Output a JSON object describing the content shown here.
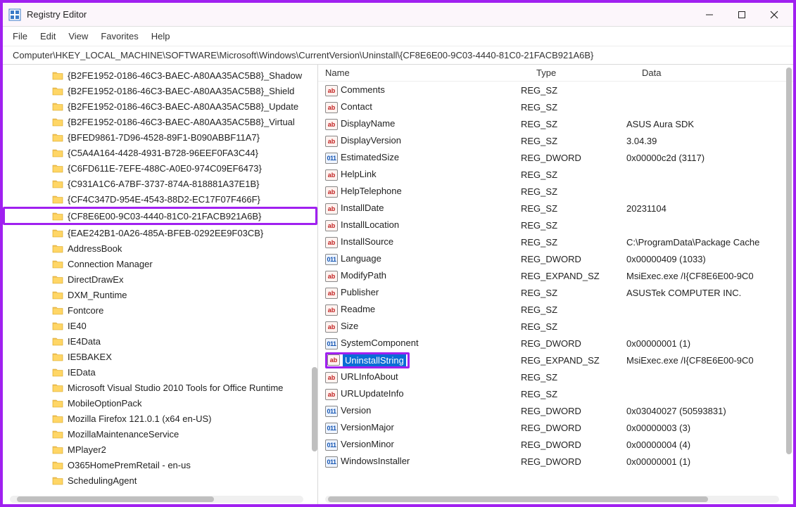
{
  "window": {
    "title": "Registry Editor"
  },
  "menu": {
    "file": "File",
    "edit": "Edit",
    "view": "View",
    "favorites": "Favorites",
    "help": "Help"
  },
  "address": "Computer\\HKEY_LOCAL_MACHINE\\SOFTWARE\\Microsoft\\Windows\\CurrentVersion\\Uninstall\\{CF8E6E00-9C03-4440-81C0-21FACB921A6B}",
  "columns": {
    "name": "Name",
    "type": "Type",
    "data": "Data"
  },
  "tree": [
    {
      "label": "{B2FE1952-0186-46C3-BAEC-A80AA35AC5B8}_Shadow"
    },
    {
      "label": "{B2FE1952-0186-46C3-BAEC-A80AA35AC5B8}_Shield"
    },
    {
      "label": "{B2FE1952-0186-46C3-BAEC-A80AA35AC5B8}_Update"
    },
    {
      "label": "{B2FE1952-0186-46C3-BAEC-A80AA35AC5B8}_Virtual"
    },
    {
      "label": "{BFED9861-7D96-4528-89F1-B090ABBF11A7}"
    },
    {
      "label": "{C5A4A164-4428-4931-B728-96EEF0FA3C44}"
    },
    {
      "label": "{C6FD611E-7EFE-488C-A0E0-974C09EF6473}"
    },
    {
      "label": "{C931A1C6-A7BF-3737-874A-818881A37E1B}"
    },
    {
      "label": "{CF4C347D-954E-4543-88D2-EC17F07F466F}"
    },
    {
      "label": "{CF8E6E00-9C03-4440-81C0-21FACB921A6B}",
      "highlighted": true
    },
    {
      "label": "{EAE242B1-0A26-485A-BFEB-0292EE9F03CB}"
    },
    {
      "label": "AddressBook"
    },
    {
      "label": "Connection Manager"
    },
    {
      "label": "DirectDrawEx"
    },
    {
      "label": "DXM_Runtime"
    },
    {
      "label": "Fontcore"
    },
    {
      "label": "IE40"
    },
    {
      "label": "IE4Data"
    },
    {
      "label": "IE5BAKEX"
    },
    {
      "label": "IEData"
    },
    {
      "label": "Microsoft Visual Studio 2010 Tools for Office Runtime"
    },
    {
      "label": "MobileOptionPack"
    },
    {
      "label": "Mozilla Firefox 121.0.1 (x64 en-US)"
    },
    {
      "label": "MozillaMaintenanceService"
    },
    {
      "label": "MPlayer2"
    },
    {
      "label": "O365HomePremRetail - en-us"
    },
    {
      "label": "SchedulingAgent"
    }
  ],
  "values": [
    {
      "icon": "sz",
      "name": "Comments",
      "type": "REG_SZ",
      "data": ""
    },
    {
      "icon": "sz",
      "name": "Contact",
      "type": "REG_SZ",
      "data": ""
    },
    {
      "icon": "sz",
      "name": "DisplayName",
      "type": "REG_SZ",
      "data": "ASUS Aura SDK"
    },
    {
      "icon": "sz",
      "name": "DisplayVersion",
      "type": "REG_SZ",
      "data": "3.04.39"
    },
    {
      "icon": "dw",
      "name": "EstimatedSize",
      "type": "REG_DWORD",
      "data": "0x00000c2d (3117)"
    },
    {
      "icon": "sz",
      "name": "HelpLink",
      "type": "REG_SZ",
      "data": ""
    },
    {
      "icon": "sz",
      "name": "HelpTelephone",
      "type": "REG_SZ",
      "data": ""
    },
    {
      "icon": "sz",
      "name": "InstallDate",
      "type": "REG_SZ",
      "data": "20231104"
    },
    {
      "icon": "sz",
      "name": "InstallLocation",
      "type": "REG_SZ",
      "data": ""
    },
    {
      "icon": "sz",
      "name": "InstallSource",
      "type": "REG_SZ",
      "data": "C:\\ProgramData\\Package Cache"
    },
    {
      "icon": "dw",
      "name": "Language",
      "type": "REG_DWORD",
      "data": "0x00000409 (1033)"
    },
    {
      "icon": "sz",
      "name": "ModifyPath",
      "type": "REG_EXPAND_SZ",
      "data": "MsiExec.exe /I{CF8E6E00-9C0"
    },
    {
      "icon": "sz",
      "name": "Publisher",
      "type": "REG_SZ",
      "data": "ASUSTek COMPUTER INC."
    },
    {
      "icon": "sz",
      "name": "Readme",
      "type": "REG_SZ",
      "data": ""
    },
    {
      "icon": "sz",
      "name": "Size",
      "type": "REG_SZ",
      "data": ""
    },
    {
      "icon": "dw",
      "name": "SystemComponent",
      "type": "REG_DWORD",
      "data": "0x00000001 (1)"
    },
    {
      "icon": "sz",
      "name": "UninstallString",
      "type": "REG_EXPAND_SZ",
      "data": "MsiExec.exe /I{CF8E6E00-9C0",
      "highlighted": true
    },
    {
      "icon": "sz",
      "name": "URLInfoAbout",
      "type": "REG_SZ",
      "data": ""
    },
    {
      "icon": "sz",
      "name": "URLUpdateInfo",
      "type": "REG_SZ",
      "data": ""
    },
    {
      "icon": "dw",
      "name": "Version",
      "type": "REG_DWORD",
      "data": "0x03040027 (50593831)"
    },
    {
      "icon": "dw",
      "name": "VersionMajor",
      "type": "REG_DWORD",
      "data": "0x00000003 (3)"
    },
    {
      "icon": "dw",
      "name": "VersionMinor",
      "type": "REG_DWORD",
      "data": "0x00000004 (4)"
    },
    {
      "icon": "dw",
      "name": "WindowsInstaller",
      "type": "REG_DWORD",
      "data": "0x00000001 (1)"
    }
  ]
}
